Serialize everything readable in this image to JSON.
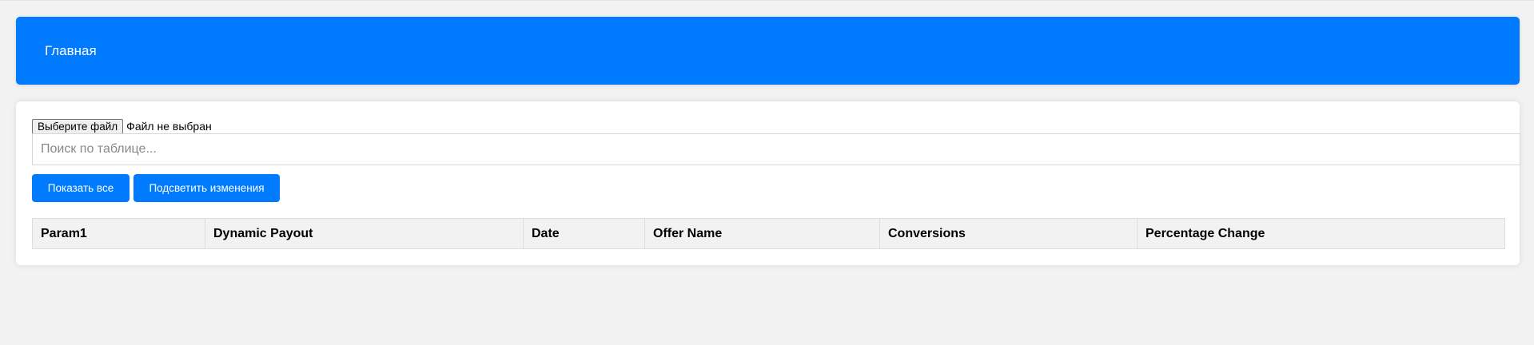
{
  "header": {
    "title": "Главная",
    "background_color": "#007bff"
  },
  "upload": {
    "button_label": "Выберите файл",
    "status_text": "Файл не выбран"
  },
  "search": {
    "placeholder": "Поиск по таблице...",
    "value": ""
  },
  "actions": {
    "show_all_label": "Показать все",
    "highlight_changes_label": "Подсветить изменения",
    "button_color": "#007bff"
  },
  "table": {
    "columns": [
      "Param1",
      "Dynamic Payout",
      "Date",
      "Offer Name",
      "Conversions",
      "Percentage Change"
    ],
    "rows": []
  }
}
